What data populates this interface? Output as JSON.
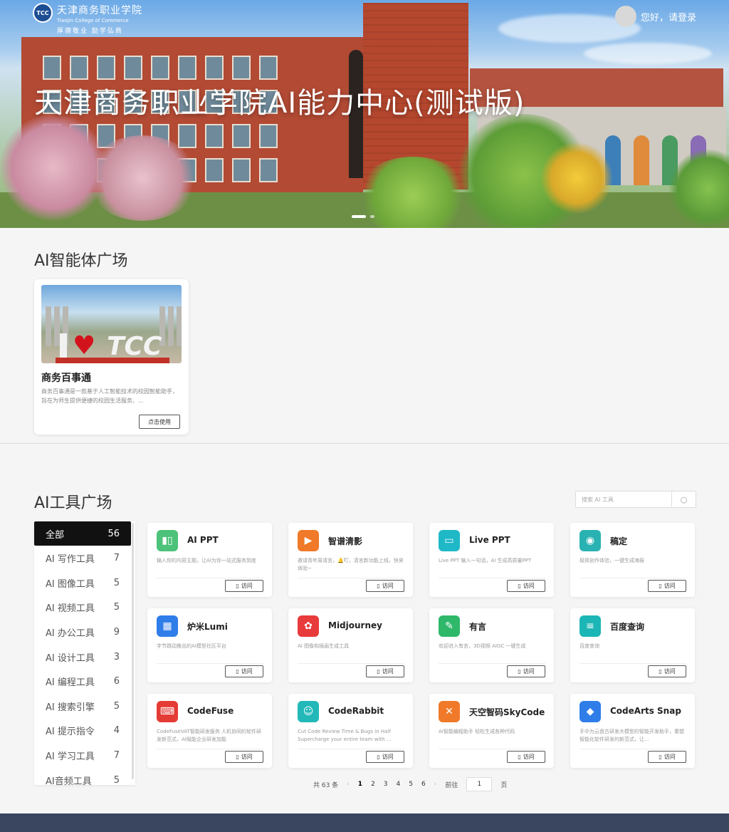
{
  "header": {
    "logo_badge": "TCC",
    "school_name_cn": "天津商务职业学院",
    "school_name_en": "Tianjin College of Commerce",
    "motto": "厚德敬业 励学弘商",
    "login_text": "您好，请登录",
    "title": "天津商务职业学院AI能力中心(测试版)"
  },
  "agents": {
    "section_title": "AI智能体广场",
    "items": [
      {
        "name": "商务百事通",
        "description": "商务百事通是一款基于人工智能技术的校园智能助手，旨在为师生提供便捷的校园生活服务、...",
        "button": "点击使用"
      }
    ]
  },
  "tools": {
    "section_title": "AI工具广场",
    "search_placeholder": "搜索 AI 工具",
    "categories": [
      {
        "label": "全部",
        "count": "56"
      },
      {
        "label": "AI 写作工具",
        "count": "7"
      },
      {
        "label": "AI 图像工具",
        "count": "5"
      },
      {
        "label": "AI 视频工具",
        "count": "5"
      },
      {
        "label": "AI 办公工具",
        "count": "9"
      },
      {
        "label": "AI 设计工具",
        "count": "3"
      },
      {
        "label": "AI 编程工具",
        "count": "6"
      },
      {
        "label": "AI 搜索引擎",
        "count": "5"
      },
      {
        "label": "AI 提示指令",
        "count": "4"
      },
      {
        "label": "AI 学习工具",
        "count": "7"
      },
      {
        "label": "AI音频工具",
        "count": "5"
      }
    ],
    "visit_label": "访问",
    "items": [
      {
        "name": "AI PPT",
        "desc": "输入你的内容主题，让AI为你一站式服务到底",
        "color": "#4cc27a",
        "icon": "ppt-icon"
      },
      {
        "name": "智谱清影",
        "desc": "邀请青年周请言，🔔叮，清言新功能上线，快来体验~",
        "color": "#f07a2a",
        "icon": "video-icon"
      },
      {
        "name": "Live PPT",
        "desc": "Live PPT 输入一句话，AI 生成高质量PPT",
        "color": "#1fb8c7",
        "icon": "folder-icon"
      },
      {
        "name": "稿定",
        "desc": "极简创作体验，一键生成海报",
        "color": "#2ab2b2",
        "icon": "design-icon"
      },
      {
        "name": "炉米Lumi",
        "desc": "字节跳动推出的AI模型社区平台",
        "color": "#2f7de8",
        "icon": "calendar-icon"
      },
      {
        "name": "Midjourney",
        "desc": "AI 图像和插画生成工具",
        "color": "#e83b3b",
        "icon": "art-icon"
      },
      {
        "name": "有言",
        "desc": "欢迎进入有言，3D视频 AIGC 一键生成",
        "color": "#2fb86a",
        "icon": "wand-icon"
      },
      {
        "name": "百度查询",
        "desc": "百度查询",
        "color": "#1db6b6",
        "icon": "books-icon"
      },
      {
        "name": "CodeFuse",
        "desc": "CodeFuseVAT智能研发服务 人机协同的软件研发新范式，AI赋能企业研发加能",
        "color": "#e53b35",
        "icon": "code-icon"
      },
      {
        "name": "CodeRabbit",
        "desc": "Cut Code Review Time & Bugs in Half Supercharge your entire team with ...",
        "color": "#22b8b8",
        "icon": "user-icon"
      },
      {
        "name": "天空智码SkyCode",
        "desc": "AI智能编程助手 轻松生成各种代码",
        "color": "#f07a2a",
        "icon": "tools-icon"
      },
      {
        "name": "CodeArts Snap",
        "desc": "手中为云盘古研发大模型的智能开发助手，重塑智能化软件研发的新范式，让...",
        "color": "#2f7de8",
        "icon": "layers-icon"
      }
    ]
  },
  "pager": {
    "total": "共 63 条",
    "pages": [
      "1",
      "2",
      "3",
      "4",
      "5",
      "6"
    ],
    "goto_label": "前往",
    "goto_value": "1",
    "page_unit": "页"
  }
}
